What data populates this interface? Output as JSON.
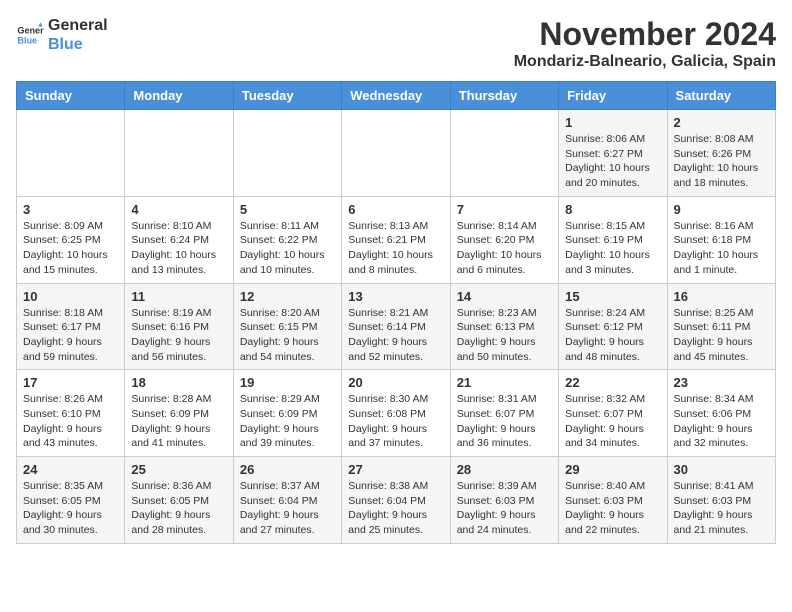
{
  "logo": {
    "line1": "General",
    "line2": "Blue"
  },
  "title": "November 2024",
  "location": "Mondariz-Balneario, Galicia, Spain",
  "days_of_week": [
    "Sunday",
    "Monday",
    "Tuesday",
    "Wednesday",
    "Thursday",
    "Friday",
    "Saturday"
  ],
  "weeks": [
    [
      {
        "day": "",
        "info": ""
      },
      {
        "day": "",
        "info": ""
      },
      {
        "day": "",
        "info": ""
      },
      {
        "day": "",
        "info": ""
      },
      {
        "day": "",
        "info": ""
      },
      {
        "day": "1",
        "info": "Sunrise: 8:06 AM\nSunset: 6:27 PM\nDaylight: 10 hours and 20 minutes."
      },
      {
        "day": "2",
        "info": "Sunrise: 8:08 AM\nSunset: 6:26 PM\nDaylight: 10 hours and 18 minutes."
      }
    ],
    [
      {
        "day": "3",
        "info": "Sunrise: 8:09 AM\nSunset: 6:25 PM\nDaylight: 10 hours and 15 minutes."
      },
      {
        "day": "4",
        "info": "Sunrise: 8:10 AM\nSunset: 6:24 PM\nDaylight: 10 hours and 13 minutes."
      },
      {
        "day": "5",
        "info": "Sunrise: 8:11 AM\nSunset: 6:22 PM\nDaylight: 10 hours and 10 minutes."
      },
      {
        "day": "6",
        "info": "Sunrise: 8:13 AM\nSunset: 6:21 PM\nDaylight: 10 hours and 8 minutes."
      },
      {
        "day": "7",
        "info": "Sunrise: 8:14 AM\nSunset: 6:20 PM\nDaylight: 10 hours and 6 minutes."
      },
      {
        "day": "8",
        "info": "Sunrise: 8:15 AM\nSunset: 6:19 PM\nDaylight: 10 hours and 3 minutes."
      },
      {
        "day": "9",
        "info": "Sunrise: 8:16 AM\nSunset: 6:18 PM\nDaylight: 10 hours and 1 minute."
      }
    ],
    [
      {
        "day": "10",
        "info": "Sunrise: 8:18 AM\nSunset: 6:17 PM\nDaylight: 9 hours and 59 minutes."
      },
      {
        "day": "11",
        "info": "Sunrise: 8:19 AM\nSunset: 6:16 PM\nDaylight: 9 hours and 56 minutes."
      },
      {
        "day": "12",
        "info": "Sunrise: 8:20 AM\nSunset: 6:15 PM\nDaylight: 9 hours and 54 minutes."
      },
      {
        "day": "13",
        "info": "Sunrise: 8:21 AM\nSunset: 6:14 PM\nDaylight: 9 hours and 52 minutes."
      },
      {
        "day": "14",
        "info": "Sunrise: 8:23 AM\nSunset: 6:13 PM\nDaylight: 9 hours and 50 minutes."
      },
      {
        "day": "15",
        "info": "Sunrise: 8:24 AM\nSunset: 6:12 PM\nDaylight: 9 hours and 48 minutes."
      },
      {
        "day": "16",
        "info": "Sunrise: 8:25 AM\nSunset: 6:11 PM\nDaylight: 9 hours and 45 minutes."
      }
    ],
    [
      {
        "day": "17",
        "info": "Sunrise: 8:26 AM\nSunset: 6:10 PM\nDaylight: 9 hours and 43 minutes."
      },
      {
        "day": "18",
        "info": "Sunrise: 8:28 AM\nSunset: 6:09 PM\nDaylight: 9 hours and 41 minutes."
      },
      {
        "day": "19",
        "info": "Sunrise: 8:29 AM\nSunset: 6:09 PM\nDaylight: 9 hours and 39 minutes."
      },
      {
        "day": "20",
        "info": "Sunrise: 8:30 AM\nSunset: 6:08 PM\nDaylight: 9 hours and 37 minutes."
      },
      {
        "day": "21",
        "info": "Sunrise: 8:31 AM\nSunset: 6:07 PM\nDaylight: 9 hours and 36 minutes."
      },
      {
        "day": "22",
        "info": "Sunrise: 8:32 AM\nSunset: 6:07 PM\nDaylight: 9 hours and 34 minutes."
      },
      {
        "day": "23",
        "info": "Sunrise: 8:34 AM\nSunset: 6:06 PM\nDaylight: 9 hours and 32 minutes."
      }
    ],
    [
      {
        "day": "24",
        "info": "Sunrise: 8:35 AM\nSunset: 6:05 PM\nDaylight: 9 hours and 30 minutes."
      },
      {
        "day": "25",
        "info": "Sunrise: 8:36 AM\nSunset: 6:05 PM\nDaylight: 9 hours and 28 minutes."
      },
      {
        "day": "26",
        "info": "Sunrise: 8:37 AM\nSunset: 6:04 PM\nDaylight: 9 hours and 27 minutes."
      },
      {
        "day": "27",
        "info": "Sunrise: 8:38 AM\nSunset: 6:04 PM\nDaylight: 9 hours and 25 minutes."
      },
      {
        "day": "28",
        "info": "Sunrise: 8:39 AM\nSunset: 6:03 PM\nDaylight: 9 hours and 24 minutes."
      },
      {
        "day": "29",
        "info": "Sunrise: 8:40 AM\nSunset: 6:03 PM\nDaylight: 9 hours and 22 minutes."
      },
      {
        "day": "30",
        "info": "Sunrise: 8:41 AM\nSunset: 6:03 PM\nDaylight: 9 hours and 21 minutes."
      }
    ]
  ]
}
